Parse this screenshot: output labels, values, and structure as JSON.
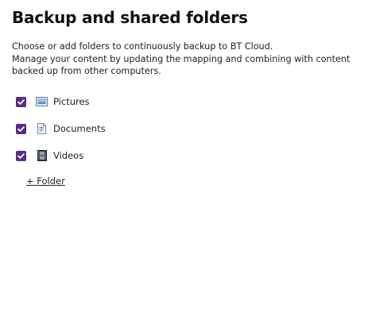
{
  "header": {
    "title": "Backup and shared folders"
  },
  "description": {
    "line1": "Choose or add folders to continuously backup to BT Cloud.",
    "line2": "Manage your content by updating the mapping and combining with content backed up from other computers."
  },
  "folders": [
    {
      "label": "Pictures",
      "checked": true,
      "icon": "pictures-folder-icon"
    },
    {
      "label": "Documents",
      "checked": true,
      "icon": "documents-folder-icon"
    },
    {
      "label": "Videos",
      "checked": true,
      "icon": "videos-folder-icon"
    }
  ],
  "add_folder": {
    "label": "+ Folder"
  },
  "colors": {
    "checkbox_accent": "#5b2a86",
    "text": "#222222",
    "background": "#ffffff"
  }
}
